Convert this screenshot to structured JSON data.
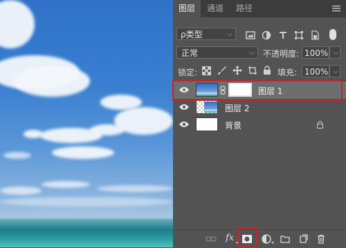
{
  "colors": {
    "accent_highlight": "#c8232c",
    "panel_bg": "#535353",
    "tabbar_bg": "#3c3c3c"
  },
  "panel": {
    "tabs": [
      {
        "label": "图层",
        "active": true
      },
      {
        "label": "通道",
        "active": false
      },
      {
        "label": "路径",
        "active": false
      }
    ],
    "filter": {
      "label": "ρ类型"
    },
    "blend_mode": "正常",
    "opacity_label": "不透明度:",
    "opacity_value": "100%",
    "lock_label": "锁定:",
    "fill_label": "填充:",
    "fill_value": "100%",
    "layers": [
      {
        "name": "图层 1",
        "selected": true,
        "visible": true,
        "has_mask": true,
        "thumb": "sky-image"
      },
      {
        "name": "图层 2",
        "selected": false,
        "visible": true,
        "has_mask": false,
        "thumb": "transparent-sky"
      },
      {
        "name": "背景",
        "selected": false,
        "visible": true,
        "has_mask": false,
        "thumb": "white",
        "locked": true
      }
    ],
    "bottom_icons": [
      "link-layers-icon",
      "fx-icon",
      "add-mask-icon",
      "adjustment-layer-icon",
      "group-folder-icon",
      "new-layer-icon",
      "trash-icon"
    ],
    "fx_text": "fx"
  }
}
